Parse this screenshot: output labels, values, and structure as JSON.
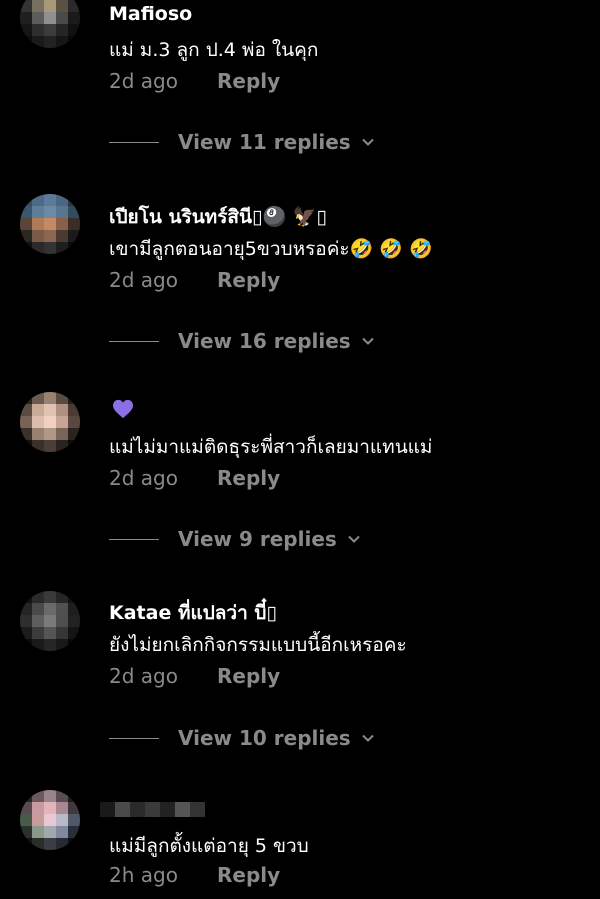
{
  "comments": [
    {
      "username": "Mafioso",
      "text": "แม่ ม.3 ลูก ป.4 พ่อ ในคุก",
      "time": "2d ago",
      "reply_label": "Reply",
      "view_replies": "View 11 replies"
    },
    {
      "username": "เปียโน นรินทร์สินี▯🎱 🦅▯",
      "text": "เขามีลูกตอนอายุ5ขวบหรอค่ะ🤣 🤣 🤣",
      "time": "2d ago",
      "reply_label": "Reply",
      "view_replies": "View 16 replies"
    },
    {
      "username": "",
      "text": "แม่ไม่มาแม่ติดธุระพี่สาวก็เลยมาแทนแม่",
      "time": "2d ago",
      "reply_label": "Reply",
      "view_replies": "View 9 replies",
      "name_icon": "purple-heart-icon"
    },
    {
      "username": "Katae ที่แปลว่า บี๋▯",
      "text": "ยังไม่ยกเลิกกิจกรรมแบบนี้อีกเหรอคะ",
      "time": "2d ago",
      "reply_label": "Reply",
      "view_replies": "View 10 replies"
    },
    {
      "username": "",
      "text": "แม่มีลูกตั้งแต่อายุ 5 ขวบ",
      "time": "2h ago",
      "reply_label": "Reply",
      "name_icon": "pixelated-username"
    }
  ],
  "colors": {
    "background": "#000000",
    "primary_text": "#ffffff",
    "secondary_text": "#8a8a8a",
    "heart": "#8b6fe8"
  }
}
